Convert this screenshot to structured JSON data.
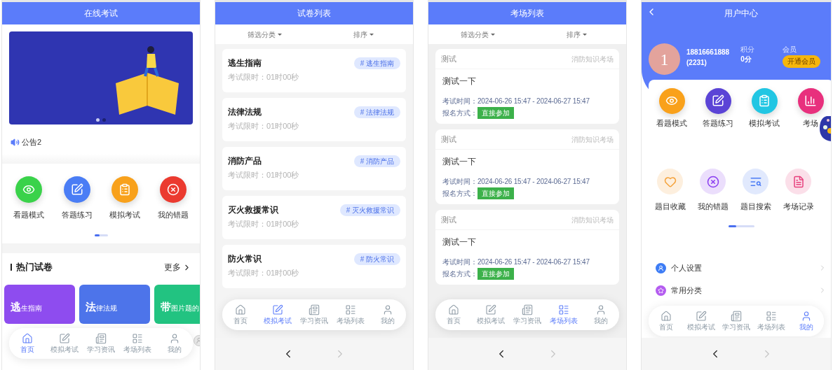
{
  "screens": [
    {
      "kind": "home",
      "title": "在线考试",
      "banner": {
        "slide_dots": [
          {
            "selected": true
          },
          {
            "selected": false
          }
        ]
      },
      "notice": "公告2",
      "shortcuts": [
        {
          "label": "看题模式",
          "color": "#3ad24a"
        },
        {
          "label": "答题练习",
          "color": "#4a7df5"
        },
        {
          "label": "模拟考试",
          "color": "#f8a11c"
        },
        {
          "label": "我的错题",
          "color": "#eb3a2f"
        }
      ],
      "section": {
        "title": "热门试卷",
        "more": "更多"
      },
      "papers": [
        {
          "title": "**逃**生指南",
          "color": "#8e4cef"
        },
        {
          "title": "**法**律法规",
          "color": "#4d74ea"
        },
        {
          "title": "**带**图片题的",
          "color": "#22c381"
        }
      ],
      "tabbar": [
        {
          "label": "首页",
          "selected": true
        },
        {
          "label": "模拟考试",
          "selected": false
        },
        {
          "label": "学习资讯",
          "selected": false
        },
        {
          "label": "考场列表",
          "selected": false
        },
        {
          "label": "我的",
          "selected": false
        }
      ]
    },
    {
      "kind": "paper_list",
      "title": "试卷列表",
      "filters": [
        "筛选分类",
        "排序"
      ],
      "papers": [
        {
          "name": "逃生指南",
          "time_limit": "考试限时：01时00秒",
          "tag": "# 逃生指南"
        },
        {
          "name": "法律法规",
          "time_limit": "考试限时：01时00秒",
          "tag": "# 法律法规"
        },
        {
          "name": "消防产品",
          "time_limit": "考试限时：01时00秒",
          "tag": "# 消防产品"
        },
        {
          "name": "灭火救援常识",
          "time_limit": "考试限时：01时00秒",
          "tag": "# 灭火救援常识"
        },
        {
          "name": "防火常识",
          "time_limit": "考试限时：01时00秒",
          "tag": "# 防火常识"
        }
      ],
      "tabbar": [
        {
          "label": "首页",
          "selected": false
        },
        {
          "label": "模拟考试",
          "selected": true
        },
        {
          "label": "学习资讯",
          "selected": false
        },
        {
          "label": "考场列表",
          "selected": false
        },
        {
          "label": "我的",
          "selected": false
        }
      ],
      "browser_bar": {
        "back_enabled": true,
        "forward_enabled": false
      }
    },
    {
      "kind": "exam_list",
      "title": "考场列表",
      "filters": [
        "筛选分类",
        "排序"
      ],
      "exams": [
        {
          "title": "测试",
          "category": "消防知识考场",
          "name": "测试一下",
          "time_label": "考试时间：",
          "time": "2024-06-26 15:47 - 2024-06-27 15:47",
          "signup_label": "报名方式：",
          "signup": "直接参加"
        },
        {
          "title": "测试",
          "category": "消防知识考场",
          "name": "测试一下",
          "time_label": "考试时间：",
          "time": "2024-06-26 15:47 - 2024-06-27 15:47",
          "signup_label": "报名方式：",
          "signup": "直接参加"
        },
        {
          "title": "测试",
          "category": "消防知识考场",
          "name": "测试一下",
          "time_label": "考试时间：",
          "time": "2024-06-26 15:47 - 2024-06-27 15:47",
          "signup_label": "报名方式：",
          "signup": "直接参加"
        }
      ],
      "tabbar": [
        {
          "label": "首页",
          "selected": false
        },
        {
          "label": "模拟考试",
          "selected": false
        },
        {
          "label": "学习资讯",
          "selected": false
        },
        {
          "label": "考场列表",
          "selected": true
        },
        {
          "label": "我的",
          "selected": false
        }
      ],
      "browser_bar": {
        "back_enabled": true,
        "forward_enabled": false
      }
    },
    {
      "kind": "user_center",
      "title": "用户中心",
      "profile": {
        "avatar": "1",
        "phone": "18816661888",
        "id": "(2231)",
        "points_label": "积分",
        "points": "0分",
        "member_label": "会员",
        "member_button": "开通会员"
      },
      "tools": [
        {
          "label": "看题模式",
          "color": "#f9a11b"
        },
        {
          "label": "答题练习",
          "color": "#5b44d6"
        },
        {
          "label": "模拟考试",
          "color": "#22c6e3"
        },
        {
          "label": "考场",
          "color": "#e8307d"
        }
      ],
      "more_tools": [
        {
          "label": "题目收藏",
          "color": "#f5a23a"
        },
        {
          "label": "我的错题",
          "color": "#8a3cf0"
        },
        {
          "label": "题目搜索",
          "color": "#4b7cf5"
        },
        {
          "label": "考场记录",
          "color": "#e8407d"
        }
      ],
      "menu": [
        {
          "label": "个人设置",
          "color": "#3d7cf5"
        },
        {
          "label": "常用分类",
          "color": "#b45cf0"
        }
      ],
      "tabbar": [
        {
          "label": "首页",
          "selected": false
        },
        {
          "label": "模拟考试",
          "selected": false
        },
        {
          "label": "学习资讯",
          "selected": false
        },
        {
          "label": "考场列表",
          "selected": false
        },
        {
          "label": "我的",
          "selected": true
        }
      ],
      "browser_bar": {
        "back_enabled": true,
        "forward_enabled": false
      }
    }
  ]
}
